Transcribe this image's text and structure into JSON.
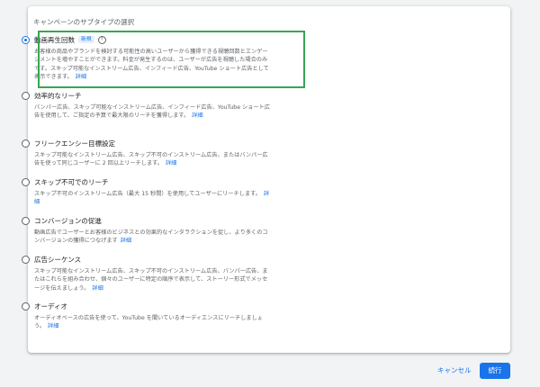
{
  "section_title": "キャンペーンのサブタイプの選択",
  "options": [
    {
      "title": "動画再生回数",
      "badge": "新規",
      "desc": "お客様の商品やブランドを検討する可能性の高いユーザーから獲得できる視聴回数とエンゲージメントを増やすことができます。料金が発生するのは、ユーザーが広告を視聴した場合のみです。スキップ可能なインストリーム広告、インフィード広告、YouTube ショート広告として表示できます。",
      "link": "詳細",
      "selected": true
    },
    {
      "title": "効率的なリーチ",
      "desc": "バンパー広告、スキップ可能なインストリーム広告、インフィード広告、YouTube ショート広告を使用して、ご指定の予算で最大限のリーチを獲得します。",
      "link": "詳細",
      "selected": false
    },
    {
      "title": "フリークエンシー目標設定",
      "desc": "スキップ可能なインストリーム広告、スキップ不可のインストリーム広告、またはバンパー広告を使って同じユーザーに 2 回以上リーチします。",
      "link": "詳細",
      "selected": false
    },
    {
      "title": "スキップ不可でのリーチ",
      "desc": "スキップ不可のインストリーム広告（最大 15 秒間）を使用してユーザーにリーチします。",
      "link": "詳細",
      "selected": false
    },
    {
      "title": "コンバージョンの促進",
      "desc": "動画広告でユーザーとお客様のビジネスとの効果的なインタラクションを促し、より多くのコンバージョンの獲得につなげます",
      "link": "詳細",
      "selected": false
    },
    {
      "title": "広告シーケンス",
      "desc": "スキップ可能なインストリーム広告、スキップ不可のインストリーム広告、バンパー広告、またはこれらを組み合わせ、個々のユーザーに特定の順序で表示して、ストーリー形式でメッセージを伝えましょう。",
      "link": "詳細",
      "selected": false
    },
    {
      "title": "オーディオ",
      "desc": "オーディオベースの広告を使って、YouTube を聞いているオーディエンスにリーチしましょう。",
      "link": "詳細",
      "selected": false
    }
  ],
  "buttons": {
    "cancel": "キャンセル",
    "run": "続行"
  },
  "colors": {
    "accent": "#1a73e8",
    "highlight": "#34a853"
  }
}
